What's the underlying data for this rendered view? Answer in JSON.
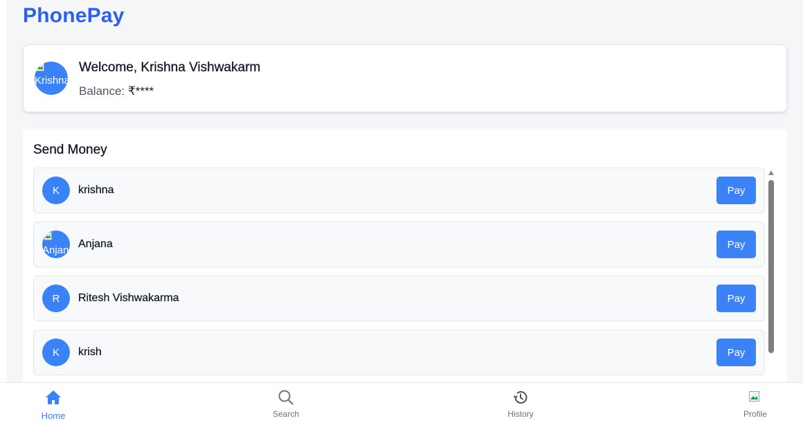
{
  "app": {
    "brand": "PhonePay"
  },
  "welcome": {
    "greeting": "Welcome, Krishna Vishwakarm",
    "balance_label": "Balance: ",
    "balance_value": "₹****",
    "avatar_alt": "Krishna"
  },
  "send_money": {
    "title": "Send Money",
    "contacts": [
      {
        "name": "krishna",
        "initial": "K",
        "pay_label": "Pay"
      },
      {
        "name": "Anjana",
        "avatar_alt": "Anjana",
        "pay_label": "Pay"
      },
      {
        "name": "Ritesh Vishwakarma",
        "initial": "R",
        "pay_label": "Pay"
      },
      {
        "name": "krish",
        "initial": "K",
        "pay_label": "Pay"
      }
    ]
  },
  "nav": {
    "home": "Home",
    "search": "Search",
    "history": "History",
    "profile": "Profile",
    "active": "home"
  },
  "colors": {
    "brand": "#2d62e5",
    "accent": "#3b82f6",
    "background": "#f5f6f8"
  }
}
